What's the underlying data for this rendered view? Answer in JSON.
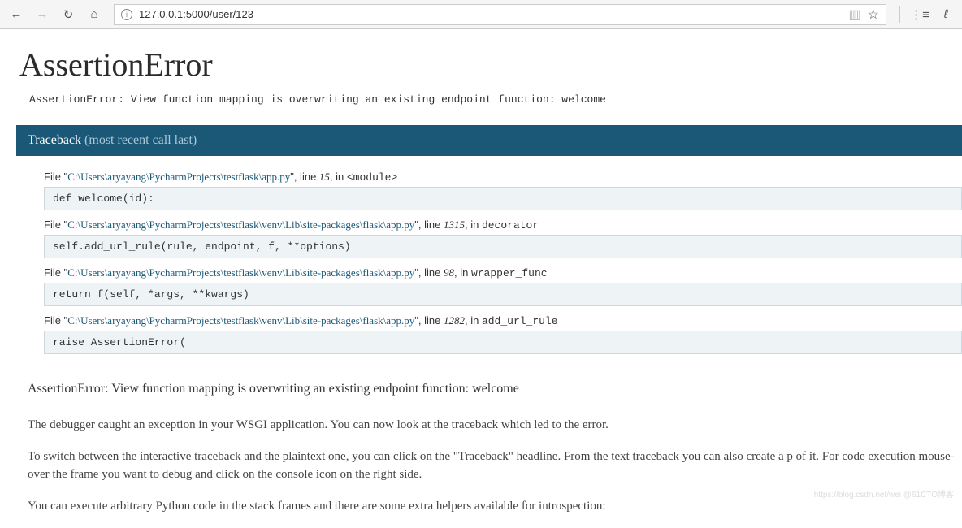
{
  "browser": {
    "url": "127.0.0.1:5000/user/123"
  },
  "page": {
    "title": "AssertionError",
    "error_line": "AssertionError: View function mapping is overwriting an existing endpoint function: welcome",
    "traceback_label": "Traceback",
    "traceback_sub": "(most recent call last)",
    "frames": [
      {
        "file": "C:\\Users\\aryayang\\PycharmProjects\\testflask\\app.py",
        "line": "15",
        "func": "<module>",
        "code": "def welcome(id):"
      },
      {
        "file": "C:\\Users\\aryayang\\PycharmProjects\\testflask\\venv\\Lib\\site-packages\\flask\\app.py",
        "line": "1315",
        "func": "decorator",
        "code": "self.add_url_rule(rule, endpoint, f, **options)"
      },
      {
        "file": "C:\\Users\\aryayang\\PycharmProjects\\testflask\\venv\\Lib\\site-packages\\flask\\app.py",
        "line": "98",
        "func": "wrapper_func",
        "code": "return f(self, *args, **kwargs)"
      },
      {
        "file": "C:\\Users\\aryayang\\PycharmProjects\\testflask\\venv\\Lib\\site-packages\\flask\\app.py",
        "line": "1282",
        "func": "add_url_rule",
        "code": "raise AssertionError("
      }
    ],
    "final_error": "AssertionError: View function mapping is overwriting an existing endpoint function: welcome",
    "desc1": "The debugger caught an exception in your WSGI application. You can now look at the traceback which led to the error.",
    "desc2": "To switch between the interactive traceback and the plaintext one, you can click on the \"Traceback\" headline. From the text traceback you can also create a p of it. For code execution mouse-over the frame you want to debug and click on the console icon on the right side.",
    "desc3": "You can execute arbitrary Python code in the stack frames and there are some extra helpers available for introspection:"
  },
  "watermark": "https://blog.csdn.net/wei @61CTO博客"
}
